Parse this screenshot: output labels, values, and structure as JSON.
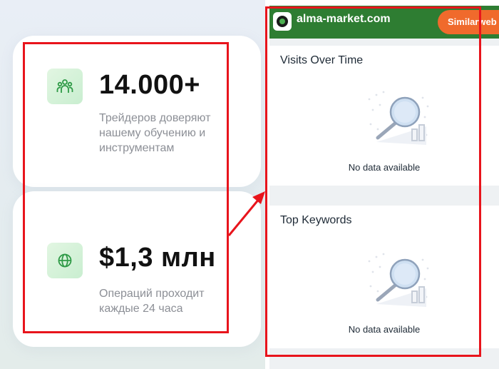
{
  "stats": [
    {
      "value": "14.000+",
      "description": [
        "Трейдеров доверяют",
        "нашему обучению и",
        "инструментам"
      ],
      "icon": "users-icon"
    },
    {
      "value": "$1,3 млн",
      "description": [
        "Операций проходит",
        "каждые 24 часа"
      ],
      "icon": "globe-icon"
    }
  ],
  "extension": {
    "domain": "alma-market.com",
    "button_label": "Similarweb P",
    "header_color": "#2e7d32",
    "button_color": "#f06a2c",
    "sections": [
      {
        "title": "Visits Over Time",
        "empty_text": "No data available",
        "icon": "magnifier-icon"
      },
      {
        "title": "Top Keywords",
        "empty_text": "No data available",
        "icon": "magnifier-icon"
      }
    ]
  },
  "annotation_color": "#e8141c"
}
